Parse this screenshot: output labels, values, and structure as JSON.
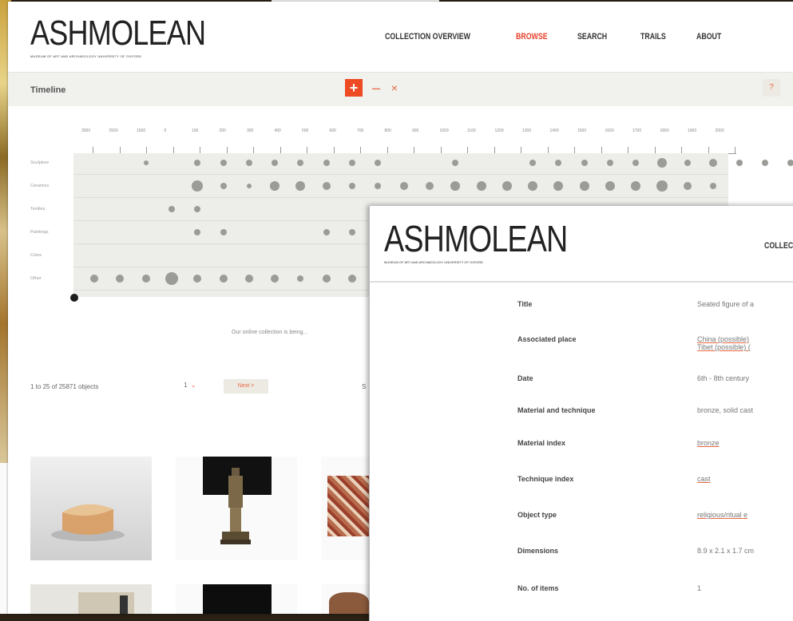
{
  "window1": {
    "logo_text": "ASHMOLEAN",
    "logo_subtext": "MUSEUM OF ART AND ARCHAEOLOGY UNIVERSITY OF OXFORD",
    "nav": [
      "COLLECTION OVERVIEW",
      "BROWSE",
      "SEARCH",
      "TRAILS",
      "ABOUT"
    ],
    "active_nav": "BROWSE",
    "timeline_title": "Timeline",
    "zoom_in": "+",
    "zoom_out": "–",
    "reset": "×",
    "help": "?",
    "year_labels": [
      "3000",
      "2500",
      "1500",
      "0",
      "100",
      "200",
      "300",
      "400",
      "500",
      "600",
      "700",
      "800",
      "900",
      "1000",
      "1100",
      "1200",
      "1300",
      "1400",
      "1500",
      "1600",
      "1700",
      "1800",
      "1900",
      "2000"
    ],
    "row_labels": [
      "Sculpture",
      "Ceramics",
      "Textiles",
      "Paintings",
      "Coins",
      "Other"
    ],
    "notice": "Our online collection is being...",
    "results_count": "1 to 25 of 25871 objects",
    "page_selector": "1",
    "next_label": "Next >",
    "sort_fragment": "S"
  },
  "window2": {
    "logo_text": "ASHMOLEAN",
    "logo_subtext": "MUSEUM OF ART AND ARCHAEOLOGY UNIVERSITY OF OXFORD",
    "nav_fragment": "COLLEC",
    "fields": [
      {
        "label": "Title",
        "value": "Seated figure of a"
      },
      {
        "label": "Associated place",
        "value": "China (possible)",
        "value2": "Tibet (possible) (",
        "linked": true
      },
      {
        "label": "Date",
        "value": "6th - 8th century"
      },
      {
        "label": "Material and technique",
        "value": "bronze, solid cast"
      },
      {
        "label": "Material index",
        "value": "bronze",
        "linked": true
      },
      {
        "label": "Technique index",
        "value": "cast",
        "linked": true
      },
      {
        "label": "Object type",
        "value": "religious/ritual e",
        "linked": true
      },
      {
        "label": "Dimensions",
        "value": "8.9 x 2.1 x 1.7 cm"
      },
      {
        "label": "No. of items",
        "value": "1"
      }
    ]
  },
  "colors": {
    "accent": "#e8412c",
    "accent_soft": "#e8673f",
    "timeline_bg": "#ededea",
    "dot": "#9b9b98"
  }
}
